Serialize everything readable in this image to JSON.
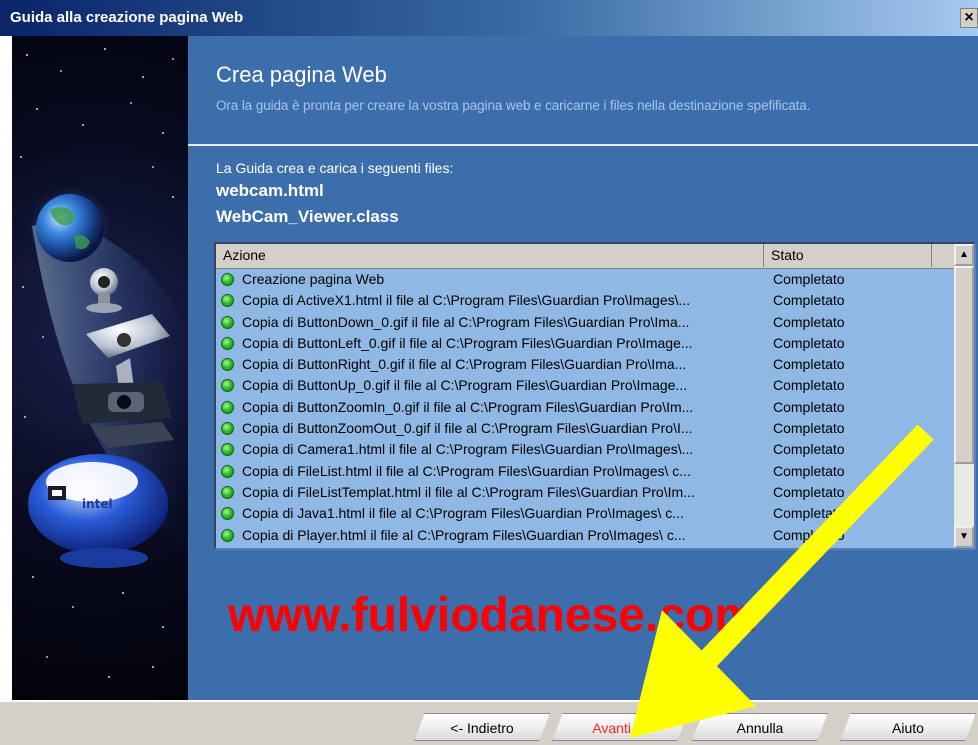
{
  "window": {
    "title": "Guida alla creazione pagina Web",
    "close_label": "×"
  },
  "page": {
    "heading": "Crea pagina Web",
    "subtitle": "Ora la guida è pronta per creare la vostra pagina web e caricarne i files nella destinazione spefificata.",
    "intro": "La Guida crea e carica i seguenti files:",
    "files": [
      "webcam.html",
      "WebCam_Viewer.class"
    ]
  },
  "table": {
    "headers": {
      "action": "Azione",
      "status": "Stato"
    },
    "rows": [
      {
        "action": "Creazione pagina Web",
        "status": "Completato"
      },
      {
        "action": "Copia di ActiveX1.html il file al C:\\Program Files\\Guardian Pro\\Images\\...",
        "status": "Completato"
      },
      {
        "action": "Copia di ButtonDown_0.gif il file al C:\\Program Files\\Guardian Pro\\Ima...",
        "status": "Completato"
      },
      {
        "action": "Copia di ButtonLeft_0.gif il file al C:\\Program Files\\Guardian Pro\\Image...",
        "status": "Completato"
      },
      {
        "action": "Copia di ButtonRight_0.gif il file al C:\\Program Files\\Guardian Pro\\Ima...",
        "status": "Completato"
      },
      {
        "action": "Copia di ButtonUp_0.gif il file al C:\\Program Files\\Guardian Pro\\Image...",
        "status": "Completato"
      },
      {
        "action": "Copia di ButtonZoomIn_0.gif il file al C:\\Program Files\\Guardian Pro\\Im...",
        "status": "Completato"
      },
      {
        "action": "Copia di ButtonZoomOut_0.gif il file al C:\\Program Files\\Guardian Pro\\I...",
        "status": "Completato"
      },
      {
        "action": "Copia di Camera1.html il file al C:\\Program Files\\Guardian Pro\\Images\\...",
        "status": "Completato"
      },
      {
        "action": "Copia di FileList.html il file al C:\\Program Files\\Guardian Pro\\Images\\ c...",
        "status": "Completato"
      },
      {
        "action": "Copia di FileListTemplat.html il file al C:\\Program Files\\Guardian Pro\\Im...",
        "status": "Completato"
      },
      {
        "action": "Copia di Java1.html il file al C:\\Program Files\\Guardian Pro\\Images\\ c...",
        "status": "Completato"
      },
      {
        "action": "Copia di Player.html il file al C:\\Program Files\\Guardian Pro\\Images\\ c...",
        "status": "Completato"
      }
    ],
    "scroll_up": "▲",
    "scroll_down": "▼"
  },
  "watermark": "www.fulviodanese.com",
  "buttons": {
    "back": "<- Indietro",
    "next": "Avanti ->",
    "cancel": "Annulla",
    "help": "Aiuto"
  },
  "colors": {
    "panel": "#3d6eac",
    "list": "#8fb8e4",
    "watermark": "#ff0000",
    "arrow": "#ffff00",
    "next_label": "#ff2020"
  }
}
